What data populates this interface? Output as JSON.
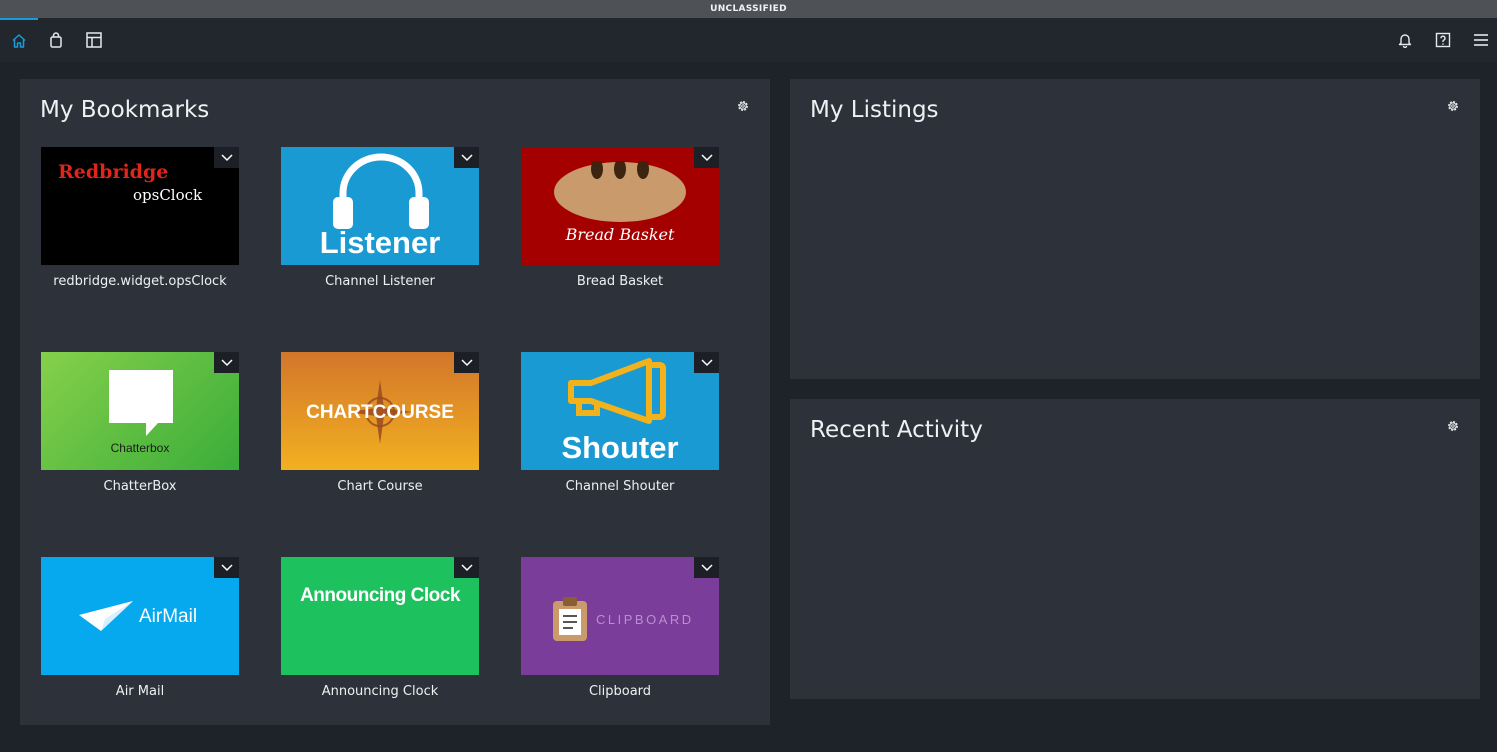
{
  "classification": "UNCLASSIFIED",
  "nav": {
    "left": [
      {
        "icon": "home-icon",
        "active": true
      },
      {
        "icon": "store-bag-icon",
        "active": false
      },
      {
        "icon": "dashboard-layout-icon",
        "active": false
      }
    ],
    "right": [
      {
        "icon": "bell-icon"
      },
      {
        "icon": "help-icon"
      },
      {
        "icon": "hamburger-menu-icon"
      }
    ]
  },
  "bookmarks": {
    "title": "My Bookmarks",
    "items": [
      {
        "label": "redbridge.widget.opsClock",
        "thumb_line1": "Redbridge",
        "thumb_line2": "opsClock",
        "bg": "#000000"
      },
      {
        "label": "Channel Listener",
        "thumb_text": "Listener",
        "bg": "#1a9ad3"
      },
      {
        "label": "Bread Basket",
        "thumb_text": "Bread Basket",
        "bg": "#a50000"
      },
      {
        "label": "ChatterBox",
        "thumb_text": "Chatterbox",
        "bg": "#5cbb3a"
      },
      {
        "label": "Chart Course",
        "thumb_text": "CHARTCOURSE",
        "bg": "#e08a1e"
      },
      {
        "label": "Channel Shouter",
        "thumb_text": "Shouter",
        "bg": "#1a9ad3"
      },
      {
        "label": "Air Mail",
        "thumb_text": "AirMail",
        "bg": "#06a8ee"
      },
      {
        "label": "Announcing Clock",
        "thumb_text": "Announcing Clock",
        "bg": "#1dc15d"
      },
      {
        "label": "Clipboard",
        "thumb_text": "CLIPBOARD",
        "bg": "#7a3d99"
      }
    ]
  },
  "listings": {
    "title": "My Listings"
  },
  "activity": {
    "title": "Recent Activity"
  },
  "colors": {
    "accent": "#1a9bd7",
    "panel": "#2d313a",
    "background": "#1e2229"
  }
}
